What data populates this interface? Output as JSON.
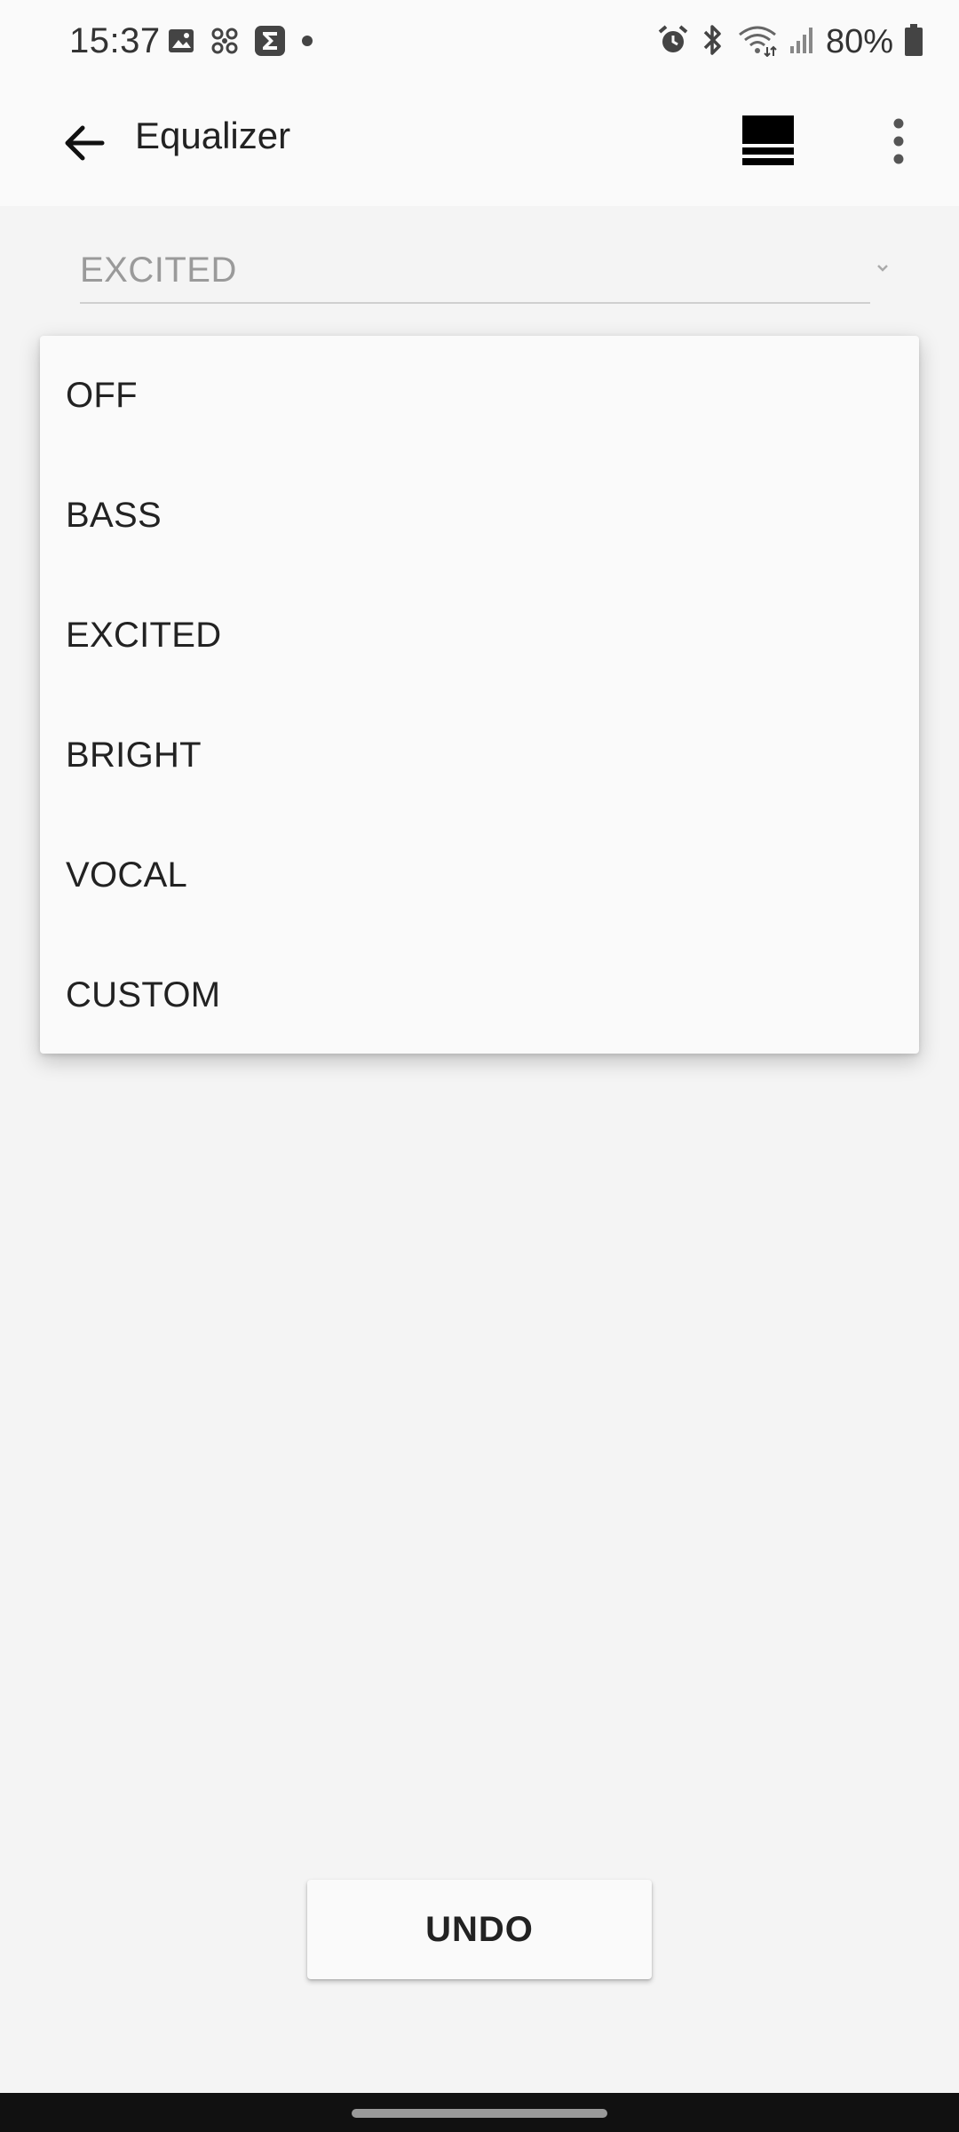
{
  "status_bar": {
    "time": "15:37",
    "battery": "80%",
    "left_icons": [
      "gallery-icon",
      "fan-icon",
      "sigma-app-icon",
      "dot-icon"
    ],
    "right_icons": [
      "alarm-icon",
      "bluetooth-icon",
      "wifi-icon",
      "signal-icon",
      "battery-icon"
    ]
  },
  "app_bar": {
    "title": "Equalizer",
    "back_icon": "arrow-back-icon",
    "preset_icon": "preset-bars-icon",
    "more_icon": "more-vert-icon"
  },
  "preset_select": {
    "selected": "EXCITED",
    "options": [
      "OFF",
      "BASS",
      "EXCITED",
      "BRIGHT",
      "VOCAL",
      "CUSTOM"
    ]
  },
  "actions": {
    "undo_label": "UNDO"
  },
  "colors": {
    "background": "#f4f4f4",
    "surface": "#fafafa",
    "text": "#222222",
    "muted": "#9a9a9a",
    "navbar": "#111111"
  }
}
